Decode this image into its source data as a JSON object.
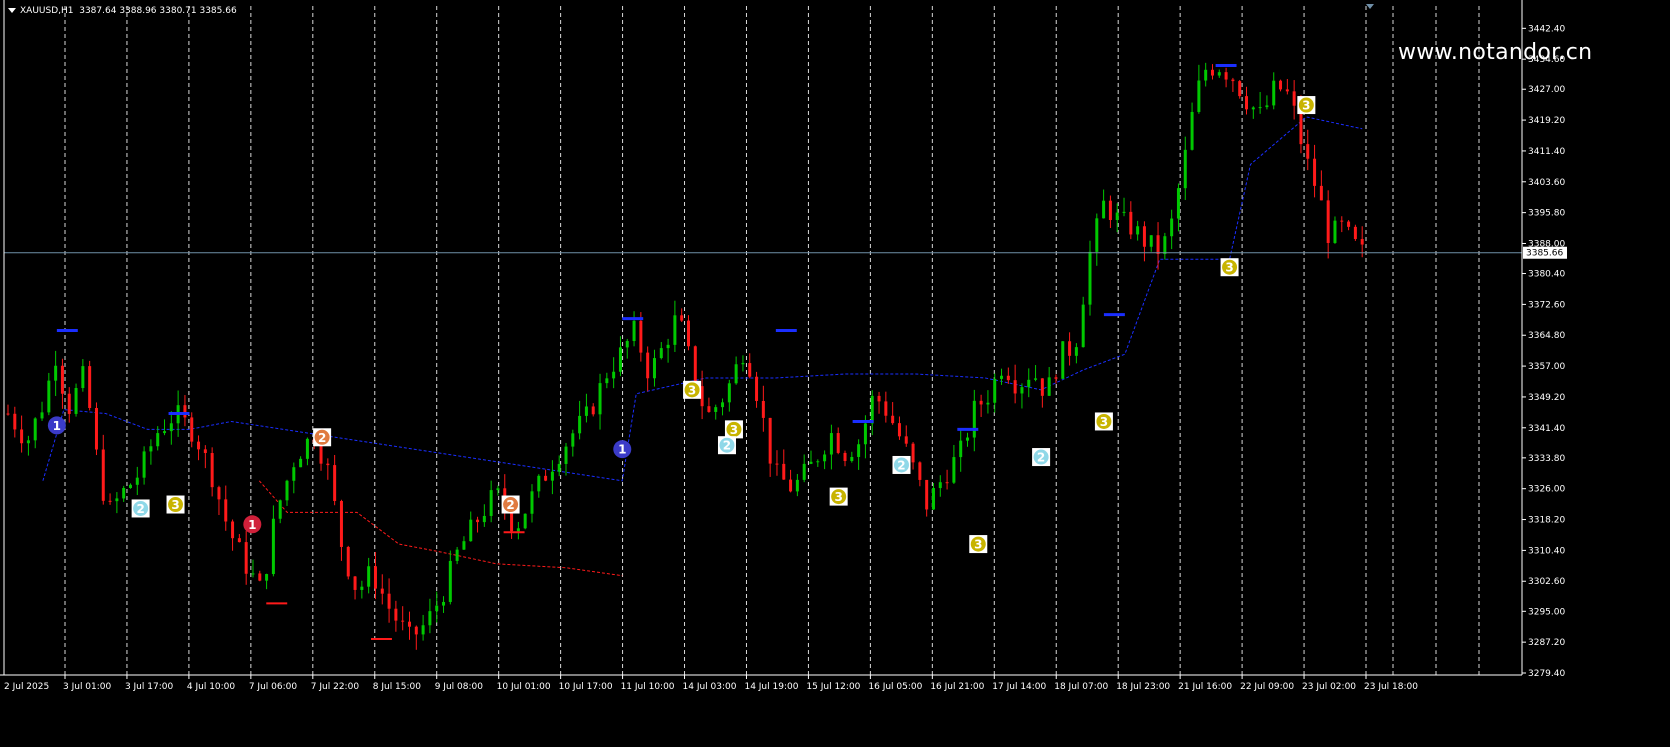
{
  "header": {
    "symbol": "XAUUSD,H1",
    "ohlc": "3387.64 3388.96 3380.71 3385.66"
  },
  "watermark": "www.notandor.cn",
  "colors": {
    "background": "#000000",
    "bull_candle": "#00c800",
    "bear_candle": "#ff1a1a",
    "grid": "#ffffff",
    "axis": "#ffffff",
    "price_line": "#6f8fa8",
    "support_line": "#1a2eff",
    "resistance_line": "#ff1a1a",
    "badge_1": "#3b3bc8",
    "badge_1_red": "#d0203a",
    "badge_2": "#e07a40",
    "badge_2_light": "#8fd8e8",
    "badge_3": "#c8b400"
  },
  "chart_data": {
    "type": "candlestick",
    "ylim": [
      3279.4,
      3444.0
    ],
    "y_ticks": [
      "3442.40",
      "3434.60",
      "3427.00",
      "3419.20",
      "3411.40",
      "3403.60",
      "3395.80",
      "3388.00",
      "3380.40",
      "3372.60",
      "3364.80",
      "3357.00",
      "3349.20",
      "3341.40",
      "3333.80",
      "3326.00",
      "3318.20",
      "3310.40",
      "3302.60",
      "3295.00",
      "3287.20",
      "3279.40"
    ],
    "x_labels": [
      "2 Jul 2025",
      "3 Jul 01:00",
      "3 Jul 17:00",
      "4 Jul 10:00",
      "7 Jul 06:00",
      "7 Jul 22:00",
      "8 Jul 15:00",
      "9 Jul 08:00",
      "10 Jul 01:00",
      "10 Jul 17:00",
      "11 Jul 10:00",
      "14 Jul 03:00",
      "14 Jul 19:00",
      "15 Jul 12:00",
      "16 Jul 05:00",
      "16 Jul 21:00",
      "17 Jul 14:00",
      "18 Jul 07:00",
      "18 Jul 23:00",
      "21 Jul 16:00",
      "22 Jul 09:00",
      "23 Jul 02:00",
      "23 Jul 18:00"
    ],
    "current_price": "3385.66",
    "close_path": [
      [
        0,
        3345
      ],
      [
        8,
        3338
      ],
      [
        15,
        3348
      ],
      [
        20,
        3360
      ],
      [
        25,
        3346
      ],
      [
        32,
        3355
      ],
      [
        38,
        3330
      ],
      [
        42,
        3320
      ],
      [
        48,
        3325
      ],
      [
        55,
        3330
      ],
      [
        62,
        3340
      ],
      [
        70,
        3345
      ],
      [
        78,
        3340
      ],
      [
        85,
        3330
      ],
      [
        92,
        3316
      ],
      [
        100,
        3306
      ],
      [
        106,
        3300
      ],
      [
        112,
        3320
      ],
      [
        120,
        3334
      ],
      [
        128,
        3340
      ],
      [
        134,
        3330
      ],
      [
        140,
        3310
      ],
      [
        146,
        3300
      ],
      [
        152,
        3305
      ],
      [
        160,
        3295
      ],
      [
        168,
        3288
      ],
      [
        175,
        3292
      ],
      [
        182,
        3300
      ],
      [
        188,
        3310
      ],
      [
        196,
        3318
      ],
      [
        204,
        3325
      ],
      [
        212,
        3316
      ],
      [
        220,
        3325
      ],
      [
        228,
        3333
      ],
      [
        236,
        3340
      ],
      [
        243,
        3345
      ],
      [
        250,
        3355
      ],
      [
        256,
        3360
      ],
      [
        262,
        3366
      ],
      [
        268,
        3355
      ],
      [
        274,
        3362
      ],
      [
        280,
        3370
      ],
      [
        286,
        3356
      ],
      [
        292,
        3344
      ],
      [
        300,
        3350
      ],
      [
        308,
        3362
      ],
      [
        314,
        3348
      ],
      [
        320,
        3330
      ],
      [
        328,
        3326
      ],
      [
        336,
        3332
      ],
      [
        344,
        3340
      ],
      [
        350,
        3335
      ],
      [
        356,
        3338
      ],
      [
        362,
        3350
      ],
      [
        368,
        3345
      ],
      [
        376,
        3335
      ],
      [
        384,
        3322
      ],
      [
        392,
        3330
      ],
      [
        398,
        3335
      ],
      [
        404,
        3346
      ],
      [
        410,
        3350
      ],
      [
        416,
        3358
      ],
      [
        422,
        3352
      ],
      [
        428,
        3356
      ],
      [
        434,
        3350
      ],
      [
        440,
        3360
      ],
      [
        446,
        3362
      ],
      [
        452,
        3385
      ],
      [
        458,
        3398
      ],
      [
        464,
        3394
      ],
      [
        470,
        3392
      ],
      [
        476,
        3388
      ],
      [
        482,
        3386
      ],
      [
        486,
        3392
      ],
      [
        492,
        3410
      ],
      [
        496,
        3424
      ],
      [
        500,
        3432
      ],
      [
        506,
        3433
      ],
      [
        512,
        3430
      ],
      [
        518,
        3424
      ],
      [
        524,
        3420
      ],
      [
        530,
        3428
      ],
      [
        536,
        3425
      ],
      [
        542,
        3410
      ],
      [
        548,
        3400
      ],
      [
        552,
        3390
      ],
      [
        558,
        3392
      ],
      [
        562,
        3388
      ],
      [
        566,
        3385.66
      ]
    ],
    "support_levels": [
      {
        "price": 3366,
        "x": [
          7,
          10
        ]
      },
      {
        "price": 3345,
        "x": [
          23,
          26
        ]
      },
      {
        "price": 3369,
        "x": [
          88,
          91
        ]
      },
      {
        "price": 3366,
        "x": [
          110,
          113
        ]
      },
      {
        "price": 3343,
        "x": [
          121,
          124
        ]
      },
      {
        "price": 3341,
        "x": [
          136,
          139
        ]
      },
      {
        "price": 3370,
        "x": [
          157,
          160
        ]
      },
      {
        "price": 3433,
        "x": [
          173,
          176
        ]
      }
    ],
    "resistance_levels": [
      {
        "price": 3297,
        "x": [
          37,
          40
        ]
      },
      {
        "price": 3288,
        "x": [
          52,
          55
        ]
      },
      {
        "price": 3315,
        "x": [
          71,
          74
        ]
      }
    ],
    "annotations": [
      {
        "label": "1",
        "style": "badge_1",
        "x": 7,
        "price": 3342
      },
      {
        "label": "2",
        "style": "badge_2_light",
        "x": 19,
        "price": 3321
      },
      {
        "label": "3",
        "style": "badge_3",
        "x": 24,
        "price": 3322
      },
      {
        "label": "1",
        "style": "badge_1_red",
        "x": 35,
        "price": 3317
      },
      {
        "label": "2",
        "style": "badge_2",
        "x": 45,
        "price": 3339
      },
      {
        "label": "2",
        "style": "badge_2",
        "x": 72,
        "price": 3322
      },
      {
        "label": "1",
        "style": "badge_1",
        "x": 88,
        "price": 3336
      },
      {
        "label": "3",
        "style": "badge_3",
        "x": 98,
        "price": 3351
      },
      {
        "label": "3",
        "style": "badge_3",
        "x": 104,
        "price": 3341
      },
      {
        "label": "2",
        "style": "badge_2_light",
        "x": 103,
        "price": 3337
      },
      {
        "label": "3",
        "style": "badge_3",
        "x": 119,
        "price": 3324
      },
      {
        "label": "2",
        "style": "badge_2_light",
        "x": 128,
        "price": 3332
      },
      {
        "label": "3",
        "style": "badge_3",
        "x": 139,
        "price": 3312
      },
      {
        "label": "2",
        "style": "badge_2_light",
        "x": 148,
        "price": 3334
      },
      {
        "label": "3",
        "style": "badge_3",
        "x": 157,
        "price": 3343
      },
      {
        "label": "3",
        "style": "badge_3",
        "x": 175,
        "price": 3382
      },
      {
        "label": "3",
        "style": "badge_3",
        "x": 186,
        "price": 3423
      }
    ],
    "ma_blue": [
      [
        5,
        3328
      ],
      [
        8,
        3346
      ],
      [
        14,
        3345
      ],
      [
        20,
        3341
      ],
      [
        26,
        3341
      ],
      [
        32,
        3343
      ],
      [
        88,
        3328
      ],
      [
        90,
        3350
      ],
      [
        100,
        3354
      ],
      [
        110,
        3354
      ],
      [
        120,
        3355
      ],
      [
        130,
        3355
      ],
      [
        140,
        3354
      ],
      [
        148,
        3351
      ],
      [
        154,
        3356
      ],
      [
        160,
        3360
      ],
      [
        165,
        3384
      ],
      [
        175,
        3384
      ],
      [
        178,
        3408
      ],
      [
        186,
        3420
      ],
      [
        194,
        3417
      ]
    ],
    "ma_red": [
      [
        36,
        3328
      ],
      [
        40,
        3320
      ],
      [
        50,
        3320
      ],
      [
        56,
        3312
      ],
      [
        62,
        3310
      ],
      [
        70,
        3307
      ],
      [
        80,
        3306
      ],
      [
        88,
        3304
      ]
    ],
    "total_bars": 200
  }
}
